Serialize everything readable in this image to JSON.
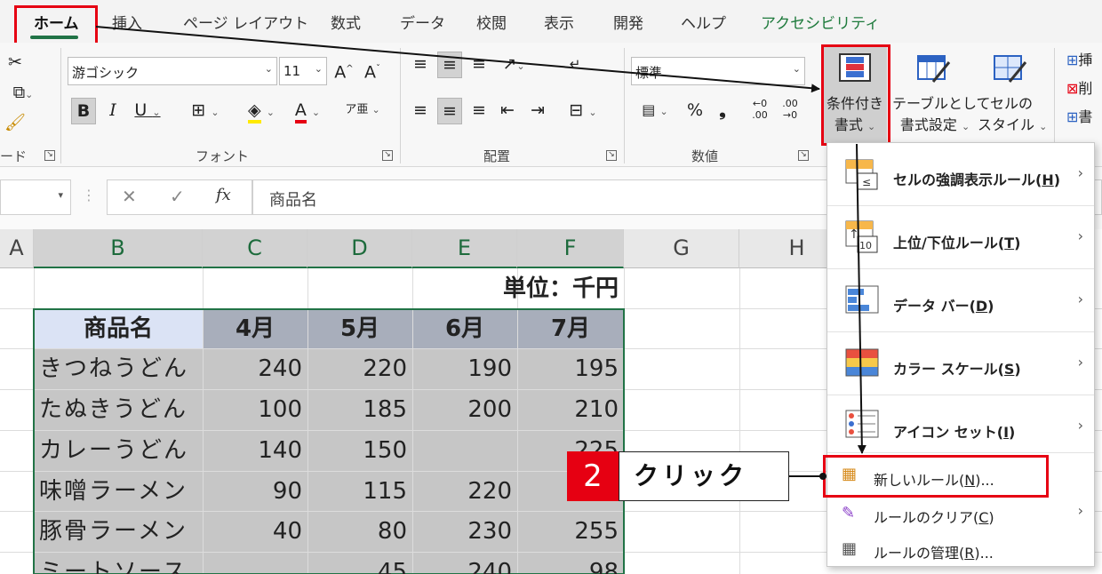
{
  "ribbon_tabs": [
    "ホーム",
    "挿入",
    "ページ レイアウト",
    "数式",
    "データ",
    "校閲",
    "表示",
    "開発",
    "ヘルプ",
    "アクセシビリティ"
  ],
  "font": {
    "name": "游ゴシック",
    "size": "11",
    "group_label": "フォント"
  },
  "clipboard": {
    "group_label": "ード"
  },
  "alignment": {
    "group_label": "配置"
  },
  "number": {
    "format": "標準",
    "group_label": "数値",
    "percent": "%",
    "comma": "❟"
  },
  "styles": {
    "conditional": [
      "条件付き",
      "書式"
    ],
    "table": [
      "テーブルとして",
      "書式設定"
    ],
    "cell_style": [
      "セルの",
      "スタイル"
    ],
    "cut_right": [
      "挿",
      "削",
      "書"
    ]
  },
  "formula_bar": {
    "fx": "fx",
    "content": "商品名"
  },
  "columns": [
    "A",
    "B",
    "C",
    "D",
    "E",
    "F",
    "G",
    "H"
  ],
  "sheet": {
    "unit_label": "単位：千円",
    "headers": [
      "商品名",
      "4月",
      "5月",
      "6月",
      "7月"
    ],
    "rows": [
      [
        "きつねうどん",
        "240",
        "220",
        "190",
        "195"
      ],
      [
        "たぬきうどん",
        "100",
        "185",
        "200",
        "210"
      ],
      [
        "カレーうどん",
        "140",
        "150",
        "",
        "225"
      ],
      [
        "味噌ラーメン",
        "90",
        "115",
        "220",
        ""
      ],
      [
        "豚骨ラーメン",
        "40",
        "80",
        "230",
        "255"
      ],
      [
        "ミートソース",
        "",
        "45",
        "240",
        "98"
      ]
    ]
  },
  "menu": {
    "items": [
      {
        "label": "セルの強調表示ルール(",
        "key": "H",
        "tail": ")"
      },
      {
        "label": "上位/下位ルール(",
        "key": "T",
        "tail": ")"
      },
      {
        "label": "データ バー(",
        "key": "D",
        "tail": ")"
      },
      {
        "label": "カラー スケール(",
        "key": "S",
        "tail": ")"
      },
      {
        "label": "アイコン セット(",
        "key": "I",
        "tail": ")"
      }
    ],
    "new_rule": {
      "label": "新しいルール(",
      "key": "N",
      "tail": ")..."
    },
    "clear_rule": {
      "label": "ルールのクリア(",
      "key": "C",
      "tail": ")"
    },
    "manage_rule": {
      "label": "ルールの管理(",
      "key": "R",
      "tail": ")..."
    }
  },
  "callout": {
    "number": "2",
    "label": "クリック"
  },
  "colors": {
    "accent_red": "#e60012",
    "excel_green": "#217346"
  }
}
